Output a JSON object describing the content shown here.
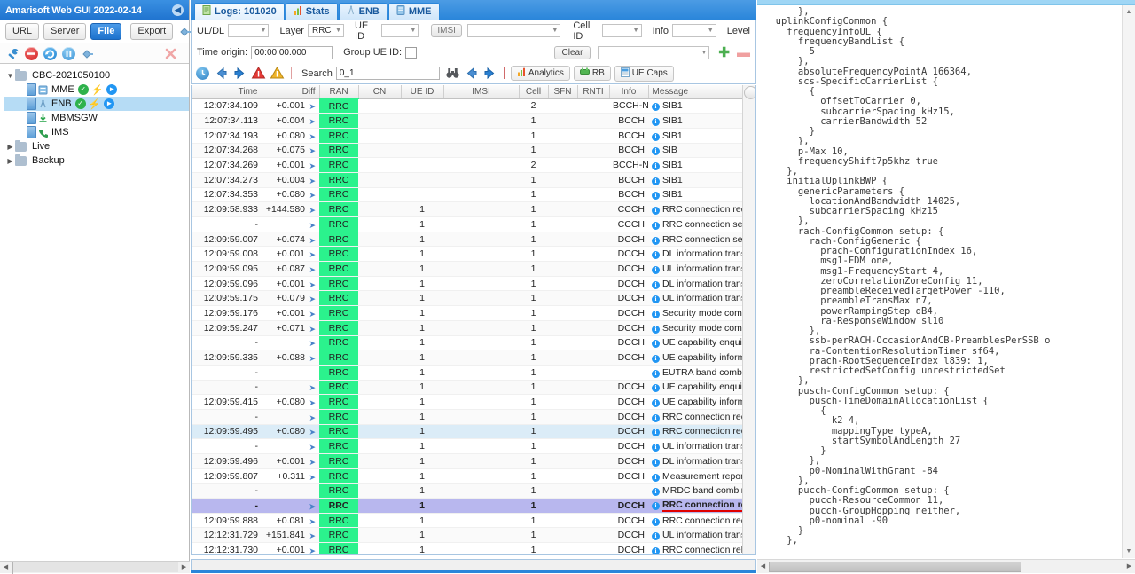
{
  "window": {
    "title": "Amarisoft Web GUI 2022-02-14",
    "collapse_icon": "chevron-left-icon"
  },
  "sidebar": {
    "source_buttons": [
      {
        "label": "URL",
        "active": false
      },
      {
        "label": "Server",
        "active": false
      },
      {
        "label": "File",
        "active": true
      }
    ],
    "export_label": "Export",
    "export_extra_icon": "plug-icon",
    "toolbar_icons": [
      {
        "name": "wrench-icon",
        "color": "#3a8fd0"
      },
      {
        "name": "stop-icon",
        "color": "#e53935"
      },
      {
        "name": "refresh-icon",
        "color": "#2196f3"
      },
      {
        "name": "pause-icon",
        "color": "#4fa8e0"
      },
      {
        "name": "plug-icon",
        "color": "#7fb3dd"
      },
      {
        "name": "close-icon",
        "color": "#f3a3a3"
      }
    ],
    "tree": [
      {
        "label": "CBC-2021050100",
        "type": "folder",
        "depth": 0,
        "expanded": true,
        "selected": false,
        "badges": []
      },
      {
        "label": "MME",
        "type": "node",
        "depth": 1,
        "selected": false,
        "badges": [
          "check",
          "bolt",
          "play"
        ]
      },
      {
        "label": "ENB",
        "type": "node",
        "depth": 1,
        "selected": true,
        "badges": [
          "check",
          "bolt",
          "play"
        ]
      },
      {
        "label": "MBMSGW",
        "type": "node",
        "depth": 1,
        "selected": false,
        "badges": []
      },
      {
        "label": "IMS",
        "type": "node",
        "depth": 1,
        "selected": false,
        "badges": []
      },
      {
        "label": "Live",
        "type": "folder",
        "depth": 0,
        "expanded": false,
        "selected": false,
        "badges": []
      },
      {
        "label": "Backup",
        "type": "folder",
        "depth": 0,
        "expanded": false,
        "selected": false,
        "badges": []
      }
    ]
  },
  "tabs": [
    {
      "label": "Logs: 101020",
      "icon": "document-icon",
      "selected": true
    },
    {
      "label": "Stats",
      "icon": "bar-chart-icon",
      "selected": false
    },
    {
      "label": "ENB",
      "icon": "antenna-icon",
      "selected": false
    },
    {
      "label": "MME",
      "icon": "server-icon",
      "selected": false
    }
  ],
  "filters": {
    "uldl_label": "UL/DL",
    "uldl_value": "",
    "layer_label": "Layer",
    "layer_value": "RRC",
    "ueid_label": "UE ID",
    "ueid_value": "",
    "imsi_label": "IMSI",
    "imsi_value": "",
    "cellid_label": "Cell ID",
    "cellid_value": "",
    "info_label": "Info",
    "info_value": "",
    "level_label": "Level",
    "time_origin_label": "Time origin:",
    "time_origin_value": "00:00:00.000",
    "group_ueid_label": "Group UE ID:",
    "group_ueid_checked": false,
    "clear_label": "Clear",
    "extra_value": "",
    "add_icon": "plus-icon",
    "remove_icon": "minus-icon"
  },
  "searchbar": {
    "icons": [
      "clock-icon",
      "arrow-left-icon",
      "arrow-right-icon",
      "error-icon",
      "warning-icon"
    ],
    "search_label": "Search",
    "search_value": "0_1",
    "binoculars_icon": "binoculars-icon",
    "prev_icon": "arrow-left-icon",
    "next_icon": "arrow-right-icon",
    "buttons": [
      {
        "label": "Analytics",
        "icon": "bar-chart-icon"
      },
      {
        "label": "RB",
        "icon": "rb-icon"
      },
      {
        "label": "UE Caps",
        "icon": "ue-caps-icon"
      }
    ]
  },
  "table": {
    "columns": [
      "Time",
      "Diff",
      "RAN",
      "CN",
      "UE ID",
      "IMSI",
      "Cell",
      "SFN",
      "RNTI",
      "Info",
      "Message"
    ],
    "rows": [
      {
        "time": "12:07:34.109",
        "diff": "+0.001",
        "arrow": true,
        "ran": "RRC",
        "cn": "",
        "ueid": "",
        "imsi": "",
        "cell": "2",
        "sfn": "",
        "rnti": "",
        "info": "BCCH-NR",
        "msg": "SIB1",
        "hl": ""
      },
      {
        "time": "12:07:34.113",
        "diff": "+0.004",
        "arrow": true,
        "ran": "RRC",
        "cn": "",
        "ueid": "",
        "imsi": "",
        "cell": "1",
        "sfn": "",
        "rnti": "",
        "info": "BCCH",
        "msg": "SIB1",
        "hl": "alt"
      },
      {
        "time": "12:07:34.193",
        "diff": "+0.080",
        "arrow": true,
        "ran": "RRC",
        "cn": "",
        "ueid": "",
        "imsi": "",
        "cell": "1",
        "sfn": "",
        "rnti": "",
        "info": "BCCH",
        "msg": "SIB1",
        "hl": ""
      },
      {
        "time": "12:07:34.268",
        "diff": "+0.075",
        "arrow": true,
        "ran": "RRC",
        "cn": "",
        "ueid": "",
        "imsi": "",
        "cell": "1",
        "sfn": "",
        "rnti": "",
        "info": "BCCH",
        "msg": "SIB",
        "hl": "alt"
      },
      {
        "time": "12:07:34.269",
        "diff": "+0.001",
        "arrow": true,
        "ran": "RRC",
        "cn": "",
        "ueid": "",
        "imsi": "",
        "cell": "2",
        "sfn": "",
        "rnti": "",
        "info": "BCCH-NR",
        "msg": "SIB1",
        "hl": ""
      },
      {
        "time": "12:07:34.273",
        "diff": "+0.004",
        "arrow": true,
        "ran": "RRC",
        "cn": "",
        "ueid": "",
        "imsi": "",
        "cell": "1",
        "sfn": "",
        "rnti": "",
        "info": "BCCH",
        "msg": "SIB1",
        "hl": "alt"
      },
      {
        "time": "12:07:34.353",
        "diff": "+0.080",
        "arrow": true,
        "ran": "RRC",
        "cn": "",
        "ueid": "",
        "imsi": "",
        "cell": "1",
        "sfn": "",
        "rnti": "",
        "info": "BCCH",
        "msg": "SIB1",
        "hl": ""
      },
      {
        "time": "12:09:58.933",
        "diff": "+144.580",
        "arrow": true,
        "ran": "RRC",
        "cn": "",
        "ueid": "1",
        "imsi": "",
        "cell": "1",
        "sfn": "",
        "rnti": "",
        "info": "CCCH",
        "msg": "RRC connection request",
        "hl": "alt"
      },
      {
        "time": "-",
        "diff": "",
        "arrow": true,
        "ran": "RRC",
        "cn": "",
        "ueid": "1",
        "imsi": "",
        "cell": "1",
        "sfn": "",
        "rnti": "",
        "info": "CCCH",
        "msg": "RRC connection setup",
        "hl": ""
      },
      {
        "time": "12:09:59.007",
        "diff": "+0.074",
        "arrow": true,
        "ran": "RRC",
        "cn": "",
        "ueid": "1",
        "imsi": "",
        "cell": "1",
        "sfn": "",
        "rnti": "",
        "info": "DCCH",
        "msg": "RRC connection setup complete",
        "hl": "alt"
      },
      {
        "time": "12:09:59.008",
        "diff": "+0.001",
        "arrow": true,
        "ran": "RRC",
        "cn": "",
        "ueid": "1",
        "imsi": "",
        "cell": "1",
        "sfn": "",
        "rnti": "",
        "info": "DCCH",
        "msg": "DL information transfer",
        "hl": ""
      },
      {
        "time": "12:09:59.095",
        "diff": "+0.087",
        "arrow": true,
        "ran": "RRC",
        "cn": "",
        "ueid": "1",
        "imsi": "",
        "cell": "1",
        "sfn": "",
        "rnti": "",
        "info": "DCCH",
        "msg": "UL information transfer",
        "hl": "alt"
      },
      {
        "time": "12:09:59.096",
        "diff": "+0.001",
        "arrow": true,
        "ran": "RRC",
        "cn": "",
        "ueid": "1",
        "imsi": "",
        "cell": "1",
        "sfn": "",
        "rnti": "",
        "info": "DCCH",
        "msg": "DL information transfer",
        "hl": ""
      },
      {
        "time": "12:09:59.175",
        "diff": "+0.079",
        "arrow": true,
        "ran": "RRC",
        "cn": "",
        "ueid": "1",
        "imsi": "",
        "cell": "1",
        "sfn": "",
        "rnti": "",
        "info": "DCCH",
        "msg": "UL information transfer",
        "hl": "alt"
      },
      {
        "time": "12:09:59.176",
        "diff": "+0.001",
        "arrow": true,
        "ran": "RRC",
        "cn": "",
        "ueid": "1",
        "imsi": "",
        "cell": "1",
        "sfn": "",
        "rnti": "",
        "info": "DCCH",
        "msg": "Security mode command",
        "hl": ""
      },
      {
        "time": "12:09:59.247",
        "diff": "+0.071",
        "arrow": true,
        "ran": "RRC",
        "cn": "",
        "ueid": "1",
        "imsi": "",
        "cell": "1",
        "sfn": "",
        "rnti": "",
        "info": "DCCH",
        "msg": "Security mode complete",
        "hl": "alt"
      },
      {
        "time": "-",
        "diff": "",
        "arrow": true,
        "ran": "RRC",
        "cn": "",
        "ueid": "1",
        "imsi": "",
        "cell": "1",
        "sfn": "",
        "rnti": "",
        "info": "DCCH",
        "msg": "UE capability enquiry",
        "hl": ""
      },
      {
        "time": "12:09:59.335",
        "diff": "+0.088",
        "arrow": true,
        "ran": "RRC",
        "cn": "",
        "ueid": "1",
        "imsi": "",
        "cell": "1",
        "sfn": "",
        "rnti": "",
        "info": "DCCH",
        "msg": "UE capability information",
        "hl": "alt"
      },
      {
        "time": "-",
        "diff": "",
        "arrow": false,
        "ran": "RRC",
        "cn": "",
        "ueid": "1",
        "imsi": "",
        "cell": "1",
        "sfn": "",
        "rnti": "",
        "info": "",
        "msg": "EUTRA band combinations",
        "hl": ""
      },
      {
        "time": "-",
        "diff": "",
        "arrow": true,
        "ran": "RRC",
        "cn": "",
        "ueid": "1",
        "imsi": "",
        "cell": "1",
        "sfn": "",
        "rnti": "",
        "info": "DCCH",
        "msg": "UE capability enquiry",
        "hl": "alt"
      },
      {
        "time": "12:09:59.415",
        "diff": "+0.080",
        "arrow": true,
        "ran": "RRC",
        "cn": "",
        "ueid": "1",
        "imsi": "",
        "cell": "1",
        "sfn": "",
        "rnti": "",
        "info": "DCCH",
        "msg": "UE capability information",
        "hl": ""
      },
      {
        "time": "-",
        "diff": "",
        "arrow": true,
        "ran": "RRC",
        "cn": "",
        "ueid": "1",
        "imsi": "",
        "cell": "1",
        "sfn": "",
        "rnti": "",
        "info": "DCCH",
        "msg": "RRC connection reconfiguration",
        "hl": "alt"
      },
      {
        "time": "12:09:59.495",
        "diff": "+0.080",
        "arrow": true,
        "ran": "RRC",
        "cn": "",
        "ueid": "1",
        "imsi": "",
        "cell": "1",
        "sfn": "",
        "rnti": "",
        "info": "DCCH",
        "msg": "RRC connection reconfiguration",
        "hl": "hl-blue"
      },
      {
        "time": "-",
        "diff": "",
        "arrow": true,
        "ran": "RRC",
        "cn": "",
        "ueid": "1",
        "imsi": "",
        "cell": "1",
        "sfn": "",
        "rnti": "",
        "info": "DCCH",
        "msg": "UL information transfer",
        "hl": ""
      },
      {
        "time": "12:09:59.496",
        "diff": "+0.001",
        "arrow": true,
        "ran": "RRC",
        "cn": "",
        "ueid": "1",
        "imsi": "",
        "cell": "1",
        "sfn": "",
        "rnti": "",
        "info": "DCCH",
        "msg": "DL information transfer",
        "hl": "alt"
      },
      {
        "time": "12:09:59.807",
        "diff": "+0.311",
        "arrow": true,
        "ran": "RRC",
        "cn": "",
        "ueid": "1",
        "imsi": "",
        "cell": "1",
        "sfn": "",
        "rnti": "",
        "info": "DCCH",
        "msg": "Measurement report",
        "hl": ""
      },
      {
        "time": "-",
        "diff": "",
        "arrow": false,
        "ran": "RRC",
        "cn": "",
        "ueid": "1",
        "imsi": "",
        "cell": "1",
        "sfn": "",
        "rnti": "",
        "info": "",
        "msg": "MRDC band combinations",
        "hl": "alt"
      },
      {
        "time": "-",
        "diff": "",
        "arrow": true,
        "ran": "RRC",
        "cn": "",
        "ueid": "1",
        "imsi": "",
        "cell": "1",
        "sfn": "",
        "rnti": "",
        "info": "DCCH",
        "msg": "RRC connection reconfiguration",
        "hl": "hl-purple"
      },
      {
        "time": "12:09:59.888",
        "diff": "+0.081",
        "arrow": true,
        "ran": "RRC",
        "cn": "",
        "ueid": "1",
        "imsi": "",
        "cell": "1",
        "sfn": "",
        "rnti": "",
        "info": "DCCH",
        "msg": "RRC connection reconfiguration",
        "hl": ""
      },
      {
        "time": "12:12:31.729",
        "diff": "+151.841",
        "arrow": true,
        "ran": "RRC",
        "cn": "",
        "ueid": "1",
        "imsi": "",
        "cell": "1",
        "sfn": "",
        "rnti": "",
        "info": "DCCH",
        "msg": "UL information transfer",
        "hl": "alt"
      },
      {
        "time": "12:12:31.730",
        "diff": "+0.001",
        "arrow": true,
        "ran": "RRC",
        "cn": "",
        "ueid": "1",
        "imsi": "",
        "cell": "1",
        "sfn": "",
        "rnti": "",
        "info": "DCCH",
        "msg": "RRC connection release",
        "hl": ""
      }
    ]
  },
  "details": {
    "code": "      },\n  uplinkConfigCommon {\n    frequencyInfoUL {\n      frequencyBandList {\n        5\n      },\n      absoluteFrequencyPointA 166364,\n      scs-SpecificCarrierList {\n        {\n          offsetToCarrier 0,\n          subcarrierSpacing kHz15,\n          carrierBandwidth 52\n        }\n      },\n      p-Max 10,\n      frequencyShift7p5khz true\n    },\n    initialUplinkBWP {\n      genericParameters {\n        locationAndBandwidth 14025,\n        subcarrierSpacing kHz15\n      },\n      rach-ConfigCommon setup: {\n        rach-ConfigGeneric {\n          prach-ConfigurationIndex 16,\n          msg1-FDM one,\n          msg1-FrequencyStart 4,\n          zeroCorrelationZoneConfig 11,\n          preambleReceivedTargetPower -110,\n          preambleTransMax n7,\n          powerRampingStep dB4,\n          ra-ResponseWindow sl10\n        },\n        ssb-perRACH-OccasionAndCB-PreamblesPerSSB o\n        ra-ContentionResolutionTimer sf64,\n        prach-RootSequenceIndex l839: 1,\n        restrictedSetConfig unrestrictedSet\n      },\n      pusch-ConfigCommon setup: {\n        pusch-TimeDomainAllocationList {\n          {\n            k2 4,\n            mappingType typeA,\n            startSymbolAndLength 27\n          }\n        },\n        p0-NominalWithGrant -84\n      },\n      pucch-ConfigCommon setup: {\n        pucch-ResourceCommon 11,\n        pucch-GroupHopping neither,\n        p0-nominal -90\n      }\n    },"
  }
}
